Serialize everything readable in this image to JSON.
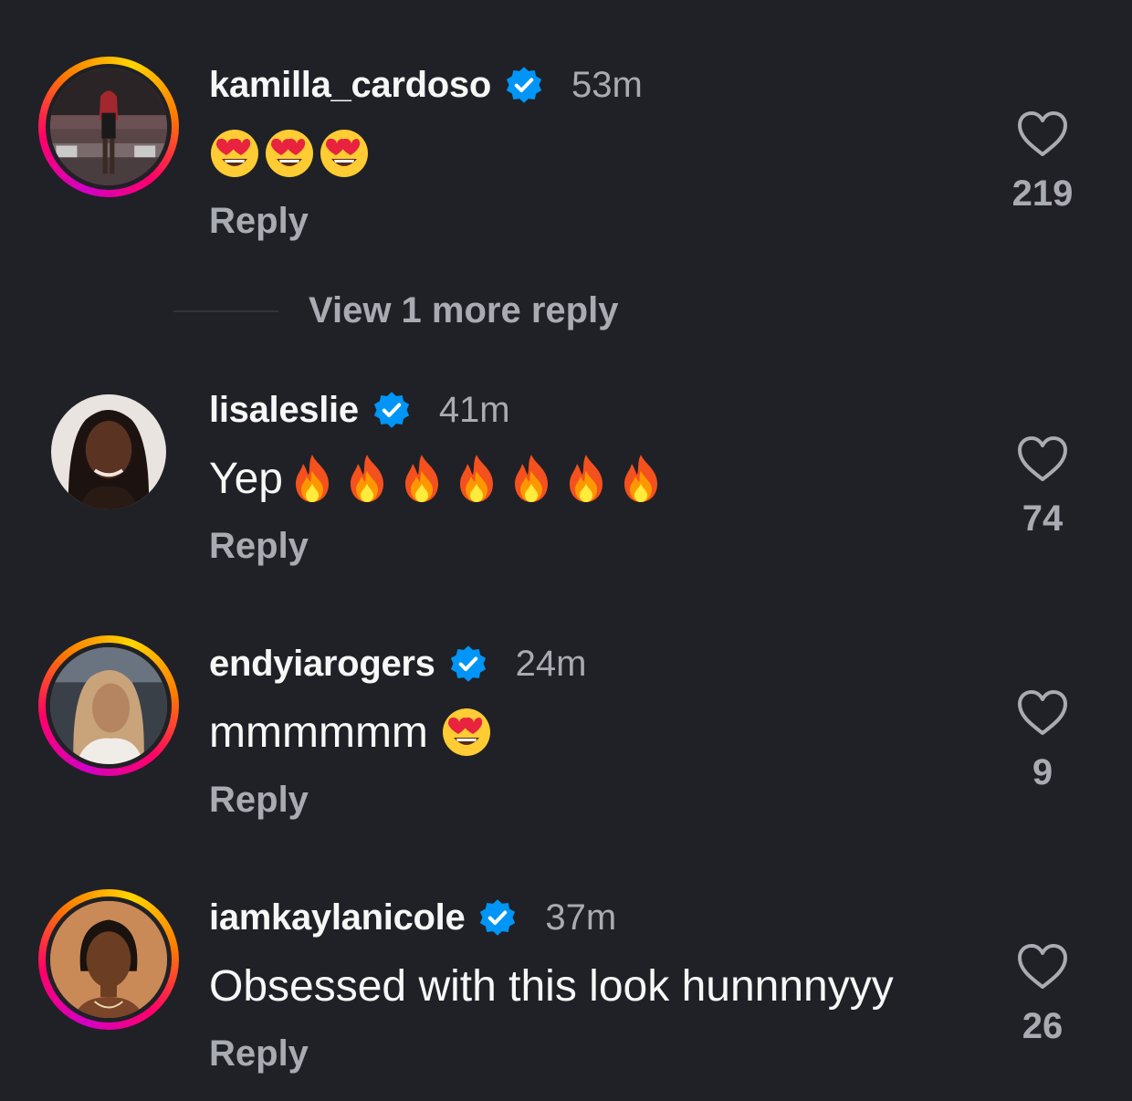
{
  "comments": [
    {
      "username": "kamilla_cardoso",
      "time": "53m",
      "text": "",
      "emojis": [
        "heart-eyes",
        "heart-eyes",
        "heart-eyes"
      ],
      "reply_label": "Reply",
      "likes": "219",
      "story_ring": true
    },
    {
      "username": "lisaleslie",
      "time": "41m",
      "text": "Yep",
      "emojis": [
        "fire",
        "fire",
        "fire",
        "fire",
        "fire",
        "fire",
        "fire"
      ],
      "reply_label": "Reply",
      "likes": "74",
      "story_ring": false
    },
    {
      "username": "endyiarogers",
      "time": "24m",
      "text": "mmmmmm",
      "emojis": [
        "heart-eyes"
      ],
      "reply_label": "Reply",
      "likes": "9",
      "story_ring": true
    },
    {
      "username": "iamkaylanicole",
      "time": "37m",
      "text": "Obsessed with this look hunnnnyyy",
      "emojis": [],
      "reply_label": "Reply",
      "likes": "26",
      "story_ring": true
    }
  ],
  "view_more": {
    "label": "View 1 more reply"
  },
  "colors": {
    "background": "#202126",
    "verified": "#0095f6",
    "secondary_text": "#a9abb3"
  }
}
